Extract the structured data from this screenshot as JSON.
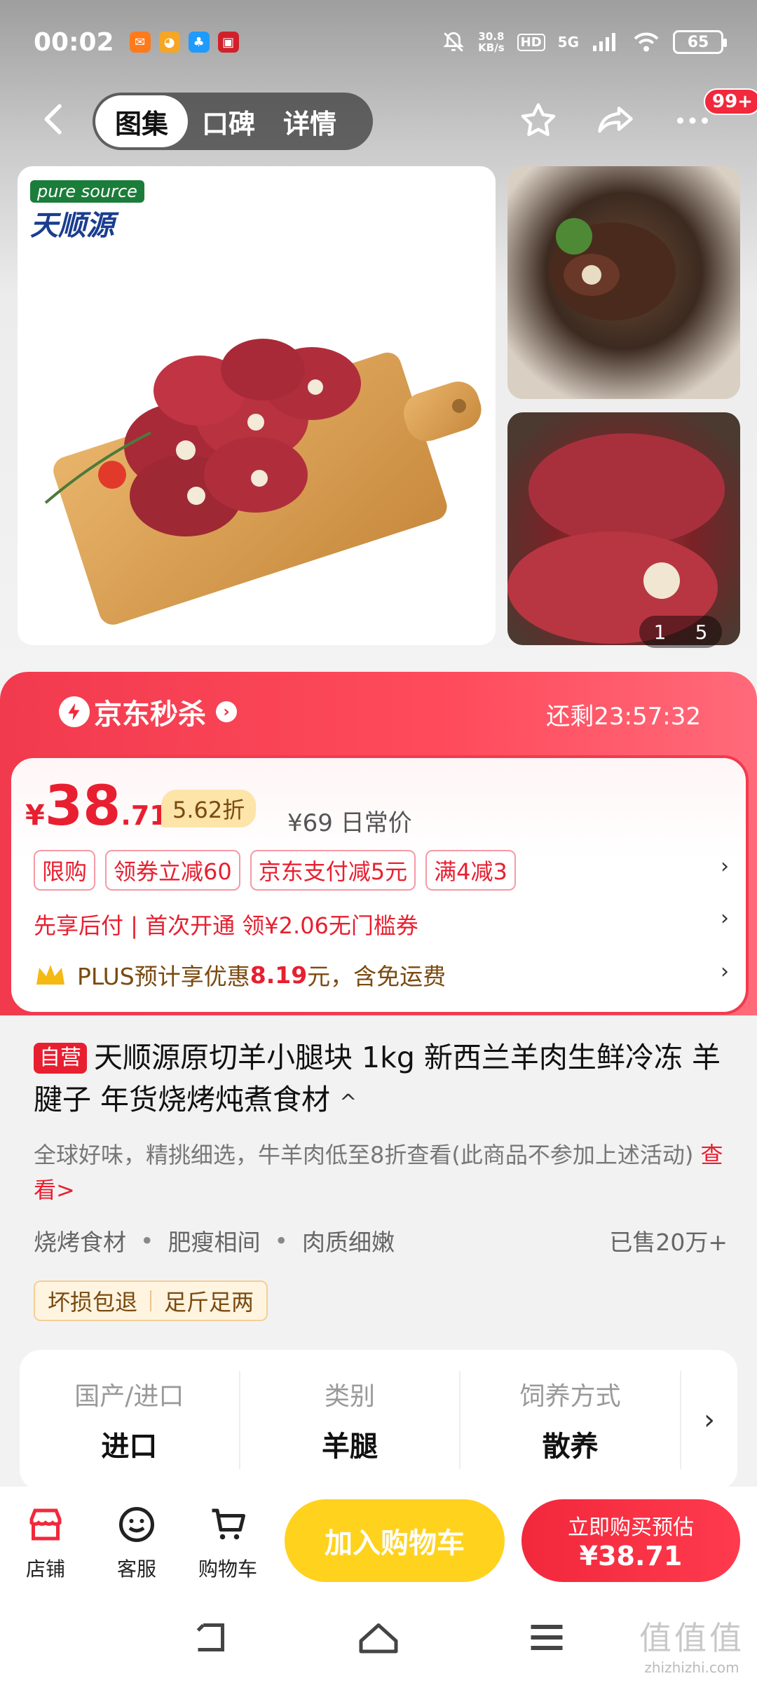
{
  "status_bar": {
    "time": "00:02",
    "net_speed": "30.8",
    "net_unit": "KB/s",
    "hd": "HD",
    "signal": "5G",
    "battery": "65"
  },
  "nav": {
    "tabs": [
      "图集",
      "口碑",
      "详情"
    ],
    "active_tab": 0,
    "more_badge": "99+"
  },
  "gallery": {
    "brand_en": "pure source",
    "brand_cn": "天顺源",
    "counter_current": "1",
    "counter_total": "5"
  },
  "flash_sale": {
    "title": "京东秒杀",
    "countdown_label": "还剩",
    "countdown": "23:57:32"
  },
  "price": {
    "currency": "¥",
    "integer": "38",
    "decimal": ".71",
    "discount": "5.62折",
    "original": "¥69 日常价",
    "promos": [
      "限购",
      "领券立减60",
      "京东支付减5元",
      "满4减3"
    ],
    "credit_line": "先享后付 | 首次开通 领¥2.06无门槛券",
    "plus_prefix": "PLUS预计享优惠",
    "plus_amount": "8.19",
    "plus_suffix": "元，含免运费"
  },
  "product": {
    "self_tag": "自营",
    "title": "天顺源原切羊小腿块 1kg 新西兰羊肉生鲜冷冻 羊腱子 年货烧烤炖煮食材",
    "title_toggle": "^",
    "desc": "全球好味，精挑细选，牛羊肉低至8折查看(此商品不参加上述活动)",
    "desc_link": "查看>",
    "tags": [
      "烧烤食材",
      "肥瘦相间",
      "肉质细嫩"
    ],
    "sold": "已售20万+",
    "services": [
      "坏损包退",
      "足斤足两"
    ]
  },
  "specs": [
    {
      "label": "国产/进口",
      "value": "进口"
    },
    {
      "label": "类别",
      "value": "羊腿"
    },
    {
      "label": "饲养方式",
      "value": "散养"
    }
  ],
  "bottom_bar": {
    "shop": "店铺",
    "service": "客服",
    "cart": "购物车",
    "add_to_cart": "加入购物车",
    "buy_now": "立即购买预估",
    "buy_price": "¥38.71"
  },
  "watermark": {
    "big": "值值值",
    "small": "zhizhizhi.com"
  },
  "colors": {
    "accent": "#f2283c",
    "yellow": "#ffd21e",
    "gold": "#7a4a10"
  }
}
